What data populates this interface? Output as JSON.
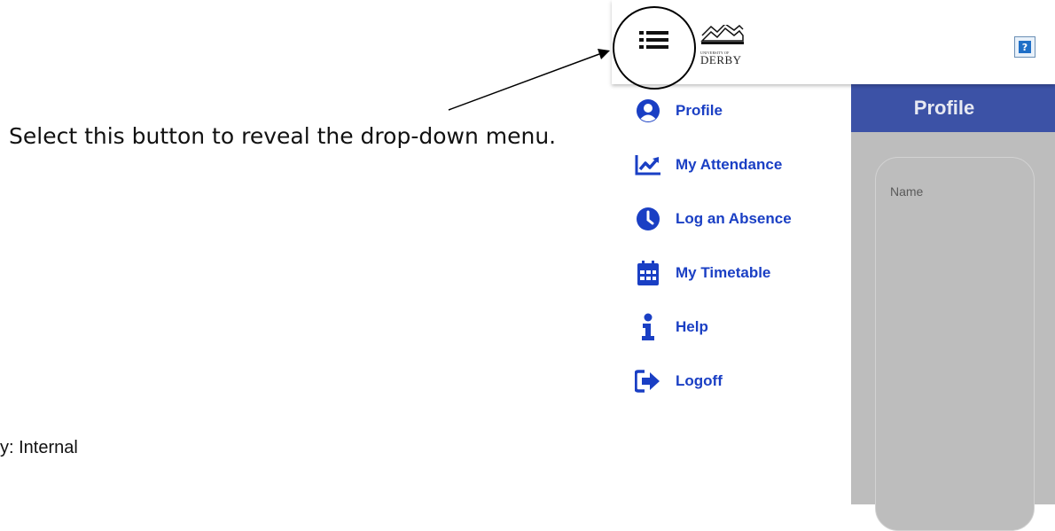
{
  "annotation": {
    "instruction": "Select this button to reveal the drop-down menu.",
    "classification": "y: Internal"
  },
  "header": {
    "menu_icon": "list-icon",
    "logo": {
      "small_text": "UNIVERSITY OF",
      "big_text": "DERBY"
    },
    "help_label": "?"
  },
  "sidebar": {
    "items": [
      {
        "label": "Profile",
        "icon": "user-circle-icon"
      },
      {
        "label": "My Attendance",
        "icon": "chart-line-icon"
      },
      {
        "label": "Log an Absence",
        "icon": "clock-icon"
      },
      {
        "label": "My Timetable",
        "icon": "calendar-icon"
      },
      {
        "label": "Help",
        "icon": "info-icon"
      },
      {
        "label": "Logoff",
        "icon": "sign-out-icon"
      }
    ]
  },
  "main": {
    "title": "Profile",
    "fields": [
      {
        "label": "Name"
      }
    ]
  },
  "colors": {
    "accent": "#1a3fc4",
    "header_bar": "#3c52a6",
    "content_bg": "#bdbdbd"
  }
}
